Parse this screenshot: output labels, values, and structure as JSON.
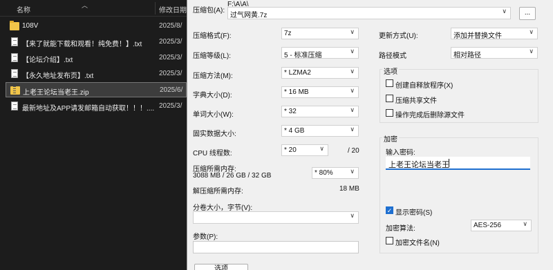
{
  "explorer": {
    "col_name": "名称",
    "col_date": "修改日期",
    "files": [
      {
        "name": "108V",
        "date": "2025/8/",
        "kind": "folder",
        "icon": "folder-icon"
      },
      {
        "name": "【来了就能下载和观看！纯免费！】.txt",
        "date": "2025/3/",
        "kind": "text",
        "icon": "text-file-icon"
      },
      {
        "name": "【论坛介绍】.txt",
        "date": "2025/3/",
        "kind": "text",
        "icon": "text-file-icon"
      },
      {
        "name": "【永久地址发布页】.txt",
        "date": "2025/3/",
        "kind": "text",
        "icon": "text-file-icon"
      },
      {
        "name": "上老王论坛当老王.zip",
        "date": "2025/6/",
        "kind": "zip",
        "icon": "zip-file-icon",
        "selected": true
      },
      {
        "name": "最新地址及APP请发邮箱自动获取！！！....",
        "date": "2025/3/",
        "kind": "text",
        "icon": "text-file-icon"
      }
    ]
  },
  "dialog": {
    "archive_label": "压缩包(A):",
    "archive_path": "F:\\A\\A\\",
    "archive_name": "过气网黄.7z",
    "browse_label": "...",
    "format_label": "压缩格式(F):",
    "format_value": "7z",
    "level_label": "压缩等级(L):",
    "level_value": "5 - 标准压缩",
    "method_label": "压缩方法(M):",
    "method_value": "* LZMA2",
    "dict_label": "字典大小(D):",
    "dict_value": "* 16 MB",
    "word_label": "单词大小(W):",
    "word_value": "* 32",
    "solid_label": "固实数据大小:",
    "solid_value": "* 4 GB",
    "threads_label": "CPU 线程数:",
    "threads_value": "* 20",
    "threads_total": "/ 20",
    "mem_label": "压缩所需内存:",
    "mem_values": "3088 MB / 26 GB / 32 GB",
    "mem_pct": "* 80%",
    "decomp_label": "解压缩所需内存:",
    "decomp_value": "18 MB",
    "split_label": "分卷大小，字节(V):",
    "split_value": "",
    "params_label": "参数(P):",
    "params_value": "",
    "options_button": "选项",
    "update_label": "更新方式(U):",
    "update_value": "添加并替换文件",
    "path_mode_label": "路径模式",
    "path_mode_value": "相对路径",
    "options_group": "选项",
    "opt_sfx": "创建自释放程序(X)",
    "opt_shared": "压缩共享文件",
    "opt_delete": "操作完成后删除源文件",
    "encrypt_group": "加密",
    "password_label": "输入密码:",
    "password_value": "上老王论坛当老王",
    "show_password": "显示密码(S)",
    "enc_method_label": "加密算法:",
    "enc_method_value": "AES-256",
    "encrypt_names": "加密文件名(N)"
  }
}
